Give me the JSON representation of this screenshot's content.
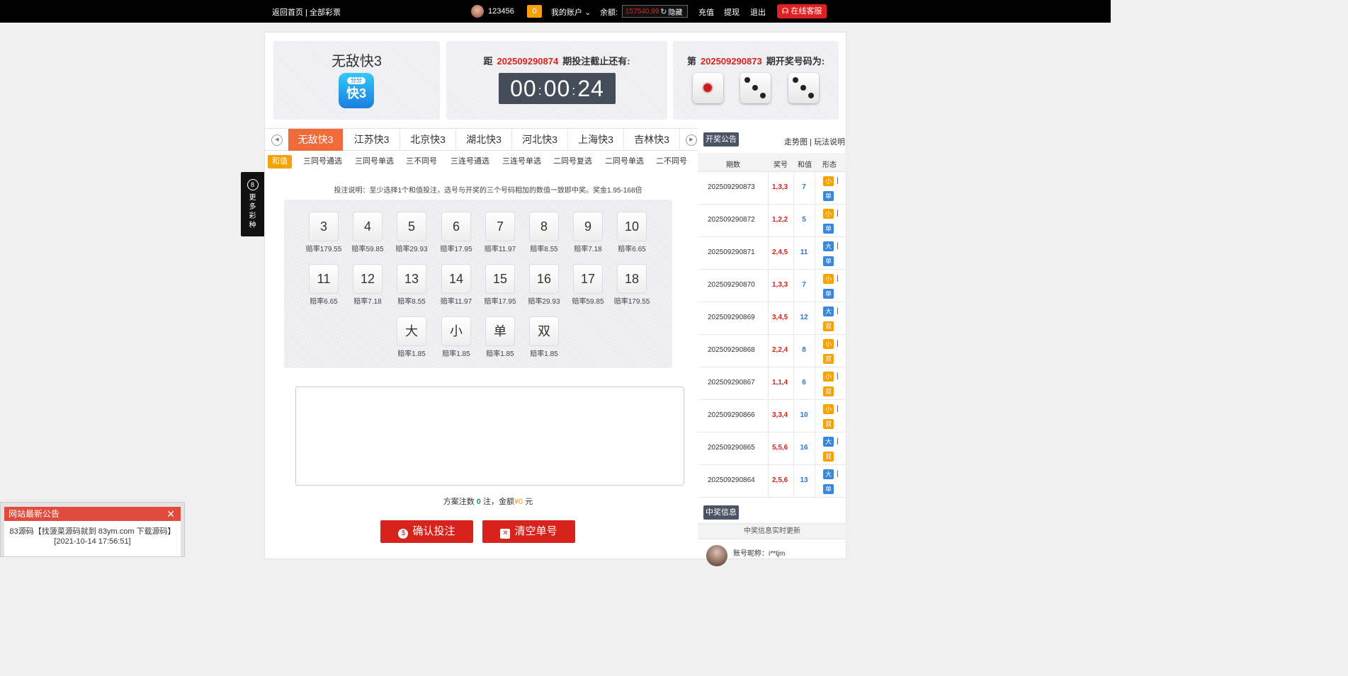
{
  "topbar": {
    "home": "返回首页",
    "separator": "|",
    "all_lottery": "全部彩票",
    "username": "123456",
    "message_count": "0",
    "my_account": "我的账户",
    "balance_label": "余额:",
    "balance": "157540.99",
    "hide": "隐藏",
    "recharge": "充值",
    "withdraw": "提现",
    "logout": "退出",
    "online_service": "在线客服"
  },
  "game": {
    "title": "无敌快3",
    "logo_top": "分分",
    "logo_main": "快3"
  },
  "countdown": {
    "prefix": "距",
    "issue": "202509290874",
    "suffix": "期投注截止还有:",
    "hh": "00",
    "mm": "00",
    "ss": "24",
    "colon": ":"
  },
  "last_draw": {
    "prefix": "第",
    "issue": "202509290873",
    "suffix": "期开奖号码为:",
    "dice": [
      1,
      3,
      3
    ]
  },
  "lottery_tabs": [
    "无敌快3",
    "江苏快3",
    "北京快3",
    "湖北快3",
    "河北快3",
    "上海快3",
    "吉林快3"
  ],
  "announce_btn": "开奖公告",
  "trend_links": "走势图 | 玩法说明",
  "play_tabs": [
    "和值",
    "三同号通选",
    "三同号单选",
    "三不同号",
    "三连号通选",
    "三连号单选",
    "二同号复选",
    "二同号单选",
    "二不同号"
  ],
  "description": "投注说明：至少选择1个和值投注，选号与开奖的三个号码相加的数值一致即中奖。奖金1.95-168倍",
  "balls": [
    {
      "n": "3",
      "odds": "赔率179.55"
    },
    {
      "n": "4",
      "odds": "赔率59.85"
    },
    {
      "n": "5",
      "odds": "赔率29.93"
    },
    {
      "n": "6",
      "odds": "赔率17.95"
    },
    {
      "n": "7",
      "odds": "赔率11.97"
    },
    {
      "n": "8",
      "odds": "赔率8.55"
    },
    {
      "n": "9",
      "odds": "赔率7.18"
    },
    {
      "n": "10",
      "odds": "赔率6.65"
    },
    {
      "n": "11",
      "odds": "赔率6.65"
    },
    {
      "n": "12",
      "odds": "赔率7.18"
    },
    {
      "n": "13",
      "odds": "赔率8.55"
    },
    {
      "n": "14",
      "odds": "赔率11.97"
    },
    {
      "n": "15",
      "odds": "赔率17.95"
    },
    {
      "n": "16",
      "odds": "赔率29.93"
    },
    {
      "n": "17",
      "odds": "赔率59.85"
    },
    {
      "n": "18",
      "odds": "赔率179.55"
    },
    {
      "n": "大",
      "odds": "赔率1.85"
    },
    {
      "n": "小",
      "odds": "赔率1.85"
    },
    {
      "n": "单",
      "odds": "赔率1.85"
    },
    {
      "n": "双",
      "odds": "赔率1.85"
    }
  ],
  "summary": {
    "text1": "方案注数",
    "count": "0",
    "text2": "注，金额",
    "amount": "¥0",
    "text3": "元"
  },
  "buttons": {
    "confirm": "确认投注",
    "clear": "清空单号"
  },
  "history": {
    "headers": [
      "期数",
      "奖号",
      "和值",
      "形态"
    ],
    "rows": [
      {
        "issue": "202509290873",
        "nums": "1,3,3",
        "sum": "7",
        "size": "小",
        "parity": "单"
      },
      {
        "issue": "202509290872",
        "nums": "1,2,2",
        "sum": "5",
        "size": "小",
        "parity": "单"
      },
      {
        "issue": "202509290871",
        "nums": "2,4,5",
        "sum": "11",
        "size": "大",
        "parity": "单"
      },
      {
        "issue": "202509290870",
        "nums": "1,3,3",
        "sum": "7",
        "size": "小",
        "parity": "单"
      },
      {
        "issue": "202509290869",
        "nums": "3,4,5",
        "sum": "12",
        "size": "大",
        "parity": "双"
      },
      {
        "issue": "202509290868",
        "nums": "2,2,4",
        "sum": "8",
        "size": "小",
        "parity": "双"
      },
      {
        "issue": "202509290867",
        "nums": "1,1,4",
        "sum": "6",
        "size": "小",
        "parity": "双"
      },
      {
        "issue": "202509290866",
        "nums": "3,3,4",
        "sum": "10",
        "size": "小",
        "parity": "双"
      },
      {
        "issue": "202509290865",
        "nums": "5,5,6",
        "sum": "16",
        "size": "大",
        "parity": "双"
      },
      {
        "issue": "202509290864",
        "nums": "2,5,6",
        "sum": "13",
        "size": "大",
        "parity": "单"
      }
    ],
    "tag_sep": "|"
  },
  "winners": {
    "button": "中奖信息",
    "header": "中奖信息实时更新",
    "first_name": "账号昵称：i**tjm"
  },
  "side_more": {
    "icon_text": "8",
    "text": "更多彩种"
  },
  "notice": {
    "title": "网站最新公告",
    "close": "✕",
    "line1": "83源码【找菠菜源码就到 83ym.com 下载源码】",
    "line2": "[2021-10-14 17:56:51]"
  },
  "colors": {
    "accent_red": "#d8231c",
    "tab_orange": "#f06a3a",
    "tag_orange": "#f5a10a",
    "tag_blue": "#3a86d8"
  }
}
